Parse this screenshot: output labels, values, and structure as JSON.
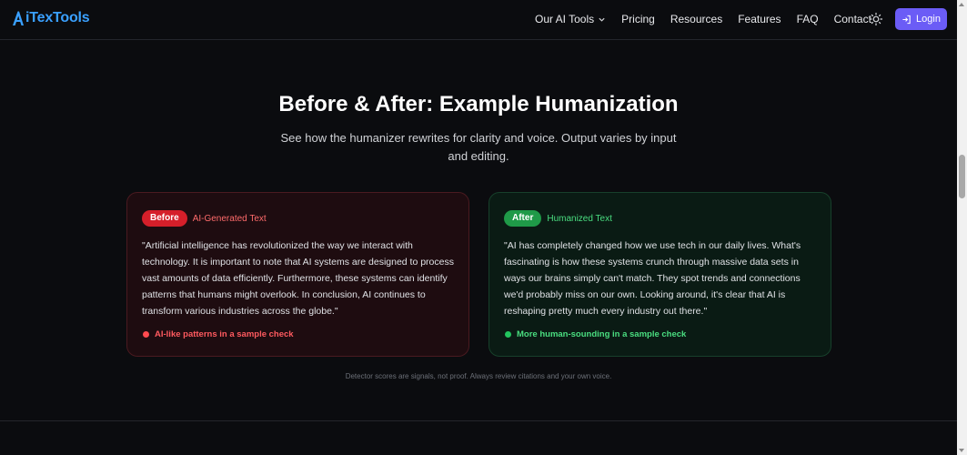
{
  "brand": {
    "name": "iTexTools",
    "logo_letter": "A",
    "color": "#3aa0ff"
  },
  "nav": {
    "items": [
      "Our AI Tools",
      "Pricing",
      "Resources",
      "Features",
      "FAQ",
      "Contact"
    ],
    "dropdown_icon": "chevron-down-icon",
    "theme_icon": "sun-icon",
    "login_label": "Login",
    "login_icon": "login-arrow-icon",
    "accent": "#6b5cf6"
  },
  "section": {
    "title": "Before & After: Example Humanization",
    "subtitle": "See how the humanizer rewrites for clarity and voice. Output varies by input and editing.",
    "disclaimer": "Detector scores are signals, not proof. Always review citations and your own voice."
  },
  "cards": {
    "before": {
      "badge": "Before",
      "label": "AI-Generated Text",
      "text": "\"Artificial intelligence has revolutionized the way we interact with technology. It is important to note that AI systems are designed to process vast amounts of data efficiently. Furthermore, these systems can identify patterns that humans might overlook. In conclusion, AI continues to transform various industries across the globe.\"",
      "footer": "AI-like patterns in a sample check",
      "accent": "#d51f2a"
    },
    "after": {
      "badge": "After",
      "label": "Humanized Text",
      "text": "\"AI has completely changed how we use tech in our daily lives. What's fascinating is how these systems crunch through massive data sets in ways our brains simply can't match. They spot trends and connections we'd probably miss on our own. Looking around, it's clear that AI is reshaping pretty much every industry out there.\"",
      "footer": "More human-sounding in a sample check",
      "accent": "#1f9a48"
    }
  }
}
